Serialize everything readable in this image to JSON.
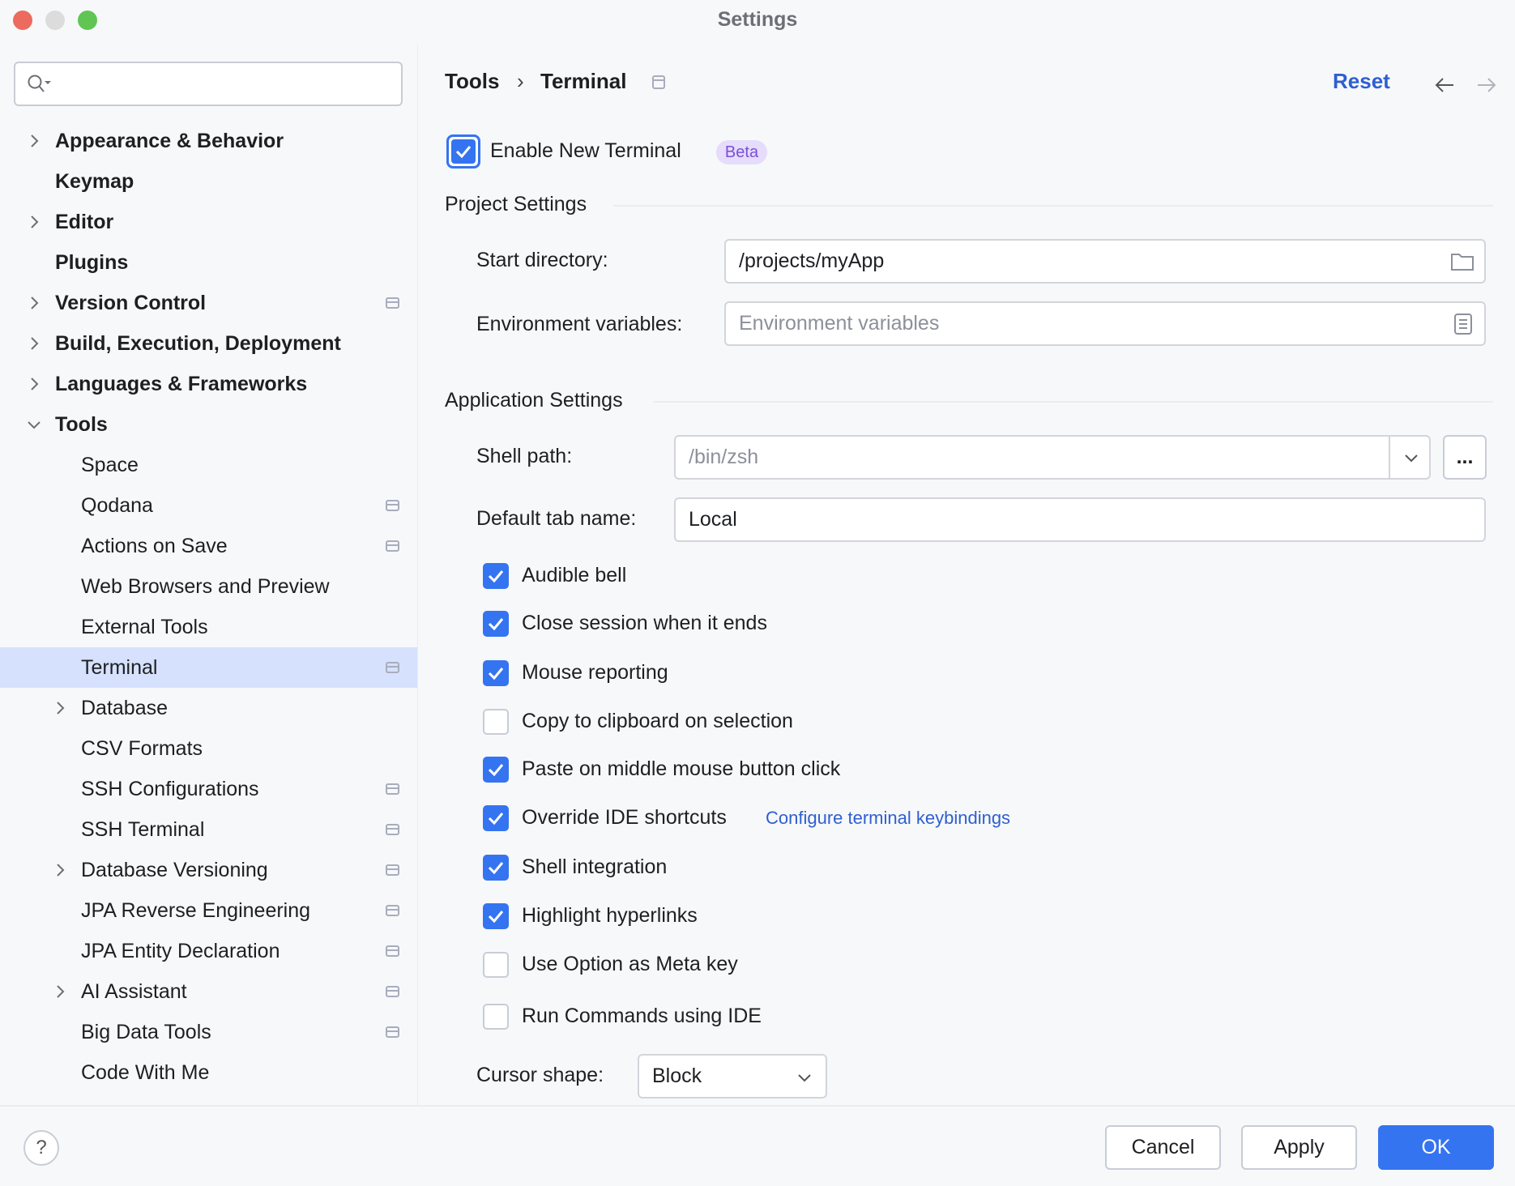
{
  "window": {
    "title": "Settings"
  },
  "search": {
    "placeholder": ""
  },
  "sidebar": {
    "items": [
      {
        "label": "Appearance & Behavior",
        "level": 0,
        "expandable": true,
        "expanded": false,
        "bold": true,
        "settings_icon": false
      },
      {
        "label": "Keymap",
        "level": 0,
        "expandable": false,
        "bold": true,
        "settings_icon": false
      },
      {
        "label": "Editor",
        "level": 0,
        "expandable": true,
        "expanded": false,
        "bold": true,
        "settings_icon": false
      },
      {
        "label": "Plugins",
        "level": 0,
        "expandable": false,
        "bold": true,
        "settings_icon": false
      },
      {
        "label": "Version Control",
        "level": 0,
        "expandable": true,
        "expanded": false,
        "bold": true,
        "settings_icon": true
      },
      {
        "label": "Build, Execution, Deployment",
        "level": 0,
        "expandable": true,
        "expanded": false,
        "bold": true,
        "settings_icon": false
      },
      {
        "label": "Languages & Frameworks",
        "level": 0,
        "expandable": true,
        "expanded": false,
        "bold": true,
        "settings_icon": false
      },
      {
        "label": "Tools",
        "level": 0,
        "expandable": true,
        "expanded": true,
        "bold": true,
        "settings_icon": false
      },
      {
        "label": "Space",
        "level": 1,
        "expandable": false,
        "settings_icon": false
      },
      {
        "label": "Qodana",
        "level": 1,
        "expandable": false,
        "settings_icon": true
      },
      {
        "label": "Actions on Save",
        "level": 1,
        "expandable": false,
        "settings_icon": true
      },
      {
        "label": "Web Browsers and Preview",
        "level": 1,
        "expandable": false,
        "settings_icon": false
      },
      {
        "label": "External Tools",
        "level": 1,
        "expandable": false,
        "settings_icon": false
      },
      {
        "label": "Terminal",
        "level": 1,
        "expandable": false,
        "settings_icon": true,
        "selected": true
      },
      {
        "label": "Database",
        "level": 1,
        "expandable": true,
        "expanded": false,
        "settings_icon": false
      },
      {
        "label": "CSV Formats",
        "level": 1,
        "expandable": false,
        "settings_icon": false
      },
      {
        "label": "SSH Configurations",
        "level": 1,
        "expandable": false,
        "settings_icon": true
      },
      {
        "label": "SSH Terminal",
        "level": 1,
        "expandable": false,
        "settings_icon": true
      },
      {
        "label": "Database Versioning",
        "level": 1,
        "expandable": true,
        "expanded": false,
        "settings_icon": true
      },
      {
        "label": "JPA Reverse Engineering",
        "level": 1,
        "expandable": false,
        "settings_icon": true
      },
      {
        "label": "JPA Entity Declaration",
        "level": 1,
        "expandable": false,
        "settings_icon": true
      },
      {
        "label": "AI Assistant",
        "level": 1,
        "expandable": true,
        "expanded": false,
        "settings_icon": true
      },
      {
        "label": "Big Data Tools",
        "level": 1,
        "expandable": false,
        "settings_icon": true
      },
      {
        "label": "Code With Me",
        "level": 1,
        "expandable": false,
        "settings_icon": false
      }
    ]
  },
  "header": {
    "breadcrumb": [
      "Tools",
      "Terminal"
    ],
    "separator": "›",
    "reset": "Reset"
  },
  "enable_new_terminal": {
    "label": "Enable New Terminal",
    "checked": true,
    "badge": "Beta"
  },
  "project_settings": {
    "title": "Project Settings",
    "start_directory_label": "Start directory:",
    "start_directory_value": "/projects/myApp",
    "env_label": "Environment variables:",
    "env_value": "",
    "env_placeholder": "Environment variables"
  },
  "application_settings": {
    "title": "Application Settings",
    "shell_path_label": "Shell path:",
    "shell_path_placeholder": "/bin/zsh",
    "browse_label": "...",
    "tab_name_label": "Default tab name:",
    "tab_name_value": "Local",
    "options": [
      {
        "label": "Audible bell",
        "checked": true
      },
      {
        "label": "Close session when it ends",
        "checked": true
      },
      {
        "label": "Mouse reporting",
        "checked": true
      },
      {
        "label": "Copy to clipboard on selection",
        "checked": false
      },
      {
        "label": "Paste on middle mouse button click",
        "checked": true
      },
      {
        "label": "Override IDE shortcuts",
        "checked": true,
        "link": "Configure terminal keybindings"
      },
      {
        "label": "Shell integration",
        "checked": true
      },
      {
        "label": "Highlight hyperlinks",
        "checked": true
      },
      {
        "label": "Use Option as Meta key",
        "checked": false
      },
      {
        "label": "Run Commands using IDE",
        "checked": false
      }
    ],
    "cursor_shape_label": "Cursor shape:",
    "cursor_shape_value": "Block"
  },
  "footer": {
    "help": "?",
    "cancel": "Cancel",
    "apply": "Apply",
    "ok": "OK"
  },
  "colors": {
    "accent": "#3574f0",
    "link": "#2e5fd1",
    "selection": "#d5e1fd",
    "beta_bg": "#e6dcfb",
    "beta_text": "#7b4fd6"
  }
}
